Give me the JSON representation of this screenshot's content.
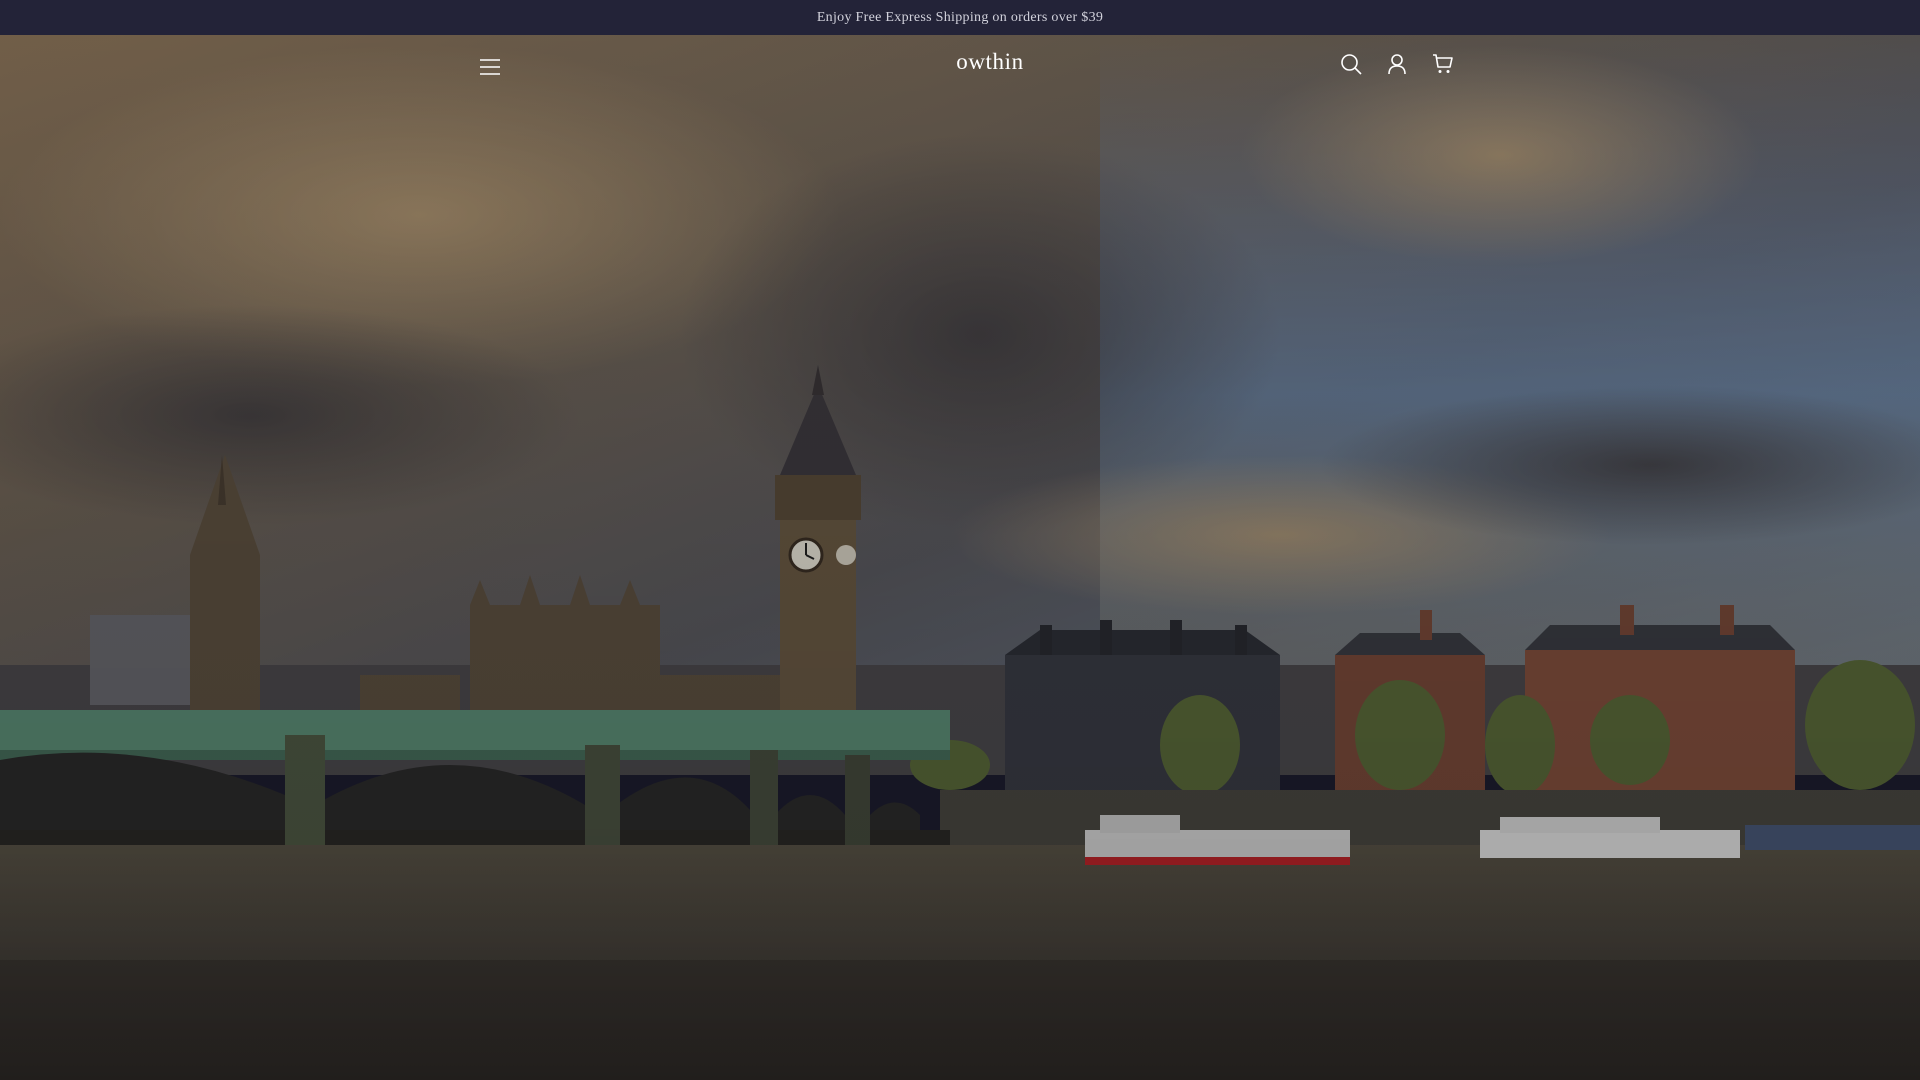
{
  "announcement": {
    "text": "Enjoy Free Express Shipping on orders over $39"
  },
  "header": {
    "logo": "owthin",
    "menu_icon": "hamburger-menu-icon",
    "icons": [
      "search-icon",
      "account-icon",
      "cart-icon"
    ]
  },
  "hero": {
    "image_subject": "london-westminster-skyline-photo"
  },
  "colors": {
    "announcement_bg": "#232338",
    "announcement_text": "#d2d2dc",
    "header_text": "#ffffff"
  }
}
